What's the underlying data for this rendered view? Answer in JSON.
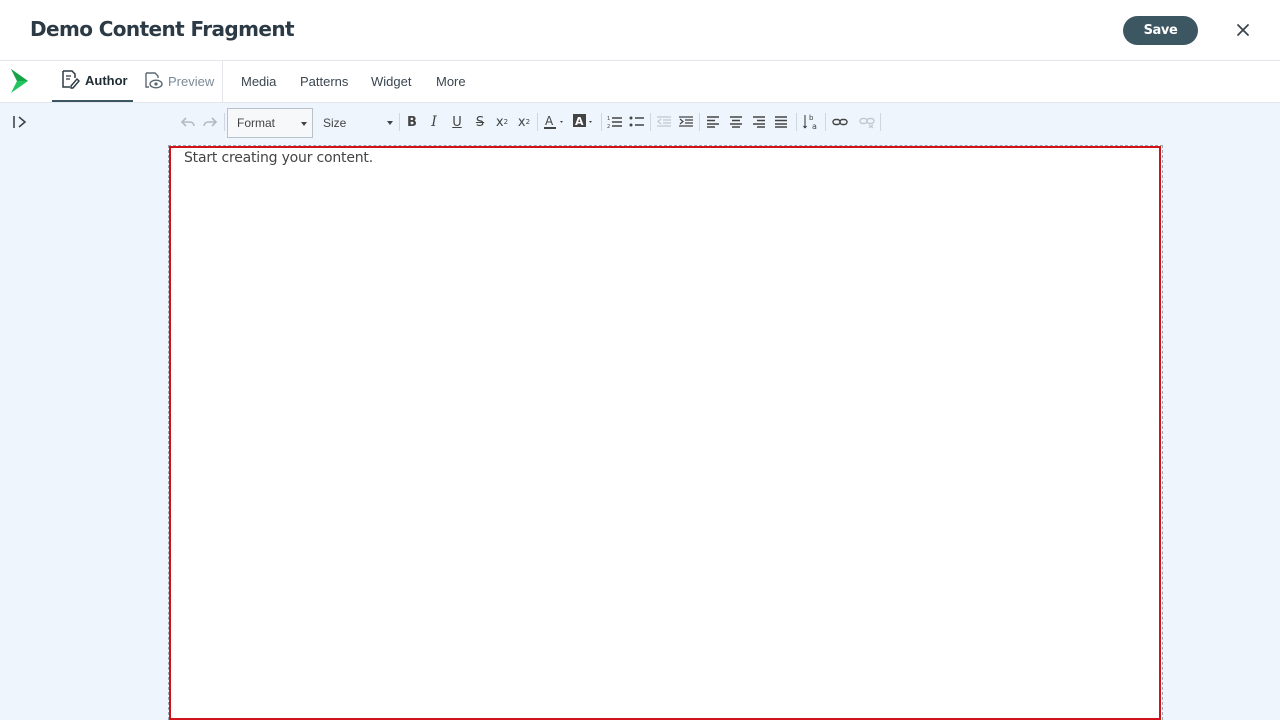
{
  "header": {
    "title": "Demo Content Fragment",
    "save_label": "Save",
    "close_icon": "close-icon"
  },
  "nav": {
    "logo_icon": "chevron-logo-icon",
    "tabs": [
      {
        "label": "Author",
        "icon": "edit-document-icon",
        "active": true
      },
      {
        "label": "Preview",
        "icon": "preview-eye-icon",
        "active": false
      }
    ],
    "links": [
      "Media",
      "Patterns",
      "Widget",
      "More"
    ]
  },
  "sidebar": {
    "toggle_icon": "expand-sidebar-icon"
  },
  "toolbar": {
    "undo_icon": "undo-icon",
    "redo_icon": "redo-icon",
    "format_label": "Format",
    "size_label": "Size",
    "buttons": [
      "bold-icon",
      "italic-icon",
      "underline-icon",
      "strikethrough-icon",
      "subscript-icon",
      "superscript-icon",
      "text-color-icon",
      "background-color-icon",
      "numbered-list-icon",
      "bulleted-list-icon",
      "decrease-indent-icon",
      "increase-indent-icon",
      "align-left-icon",
      "align-center-icon",
      "align-right-icon",
      "justify-icon",
      "text-direction-icon",
      "link-icon",
      "unlink-icon"
    ]
  },
  "editor": {
    "placeholder": "Start creating your content."
  },
  "colors": {
    "accent": "#3c5662",
    "logo_green": "#22c55e",
    "editor_border": "#d0121b",
    "background": "#eef5fd"
  }
}
